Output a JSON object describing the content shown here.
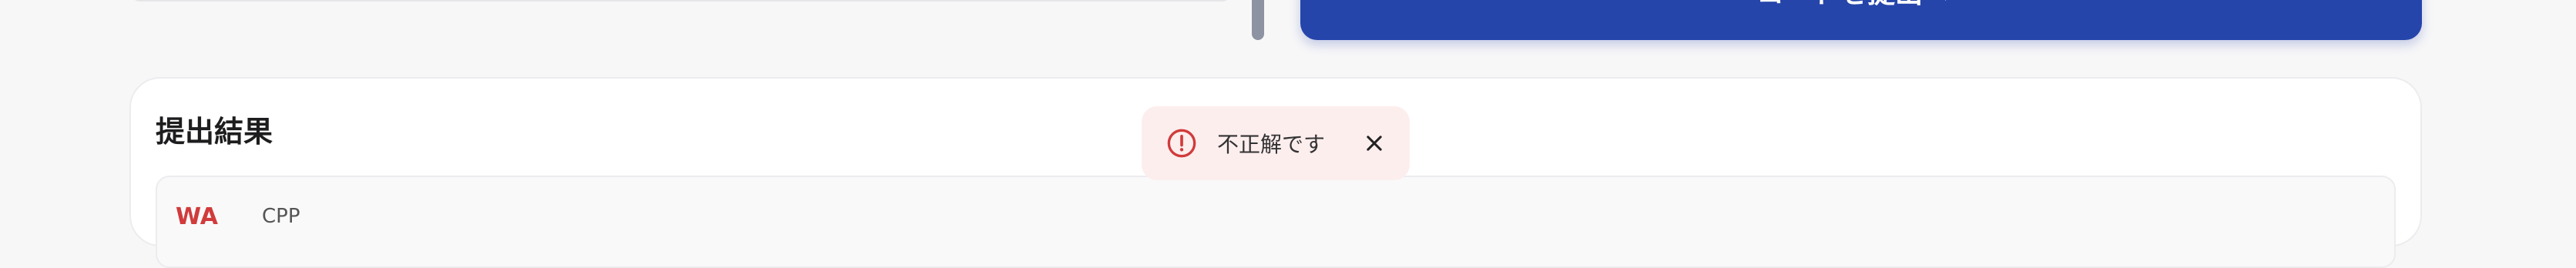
{
  "submit": {
    "label": "コードを提出"
  },
  "results": {
    "title": "提出結果",
    "rows": [
      {
        "status": "WA",
        "language": "CPP"
      }
    ]
  },
  "toast": {
    "message": "不正解です"
  },
  "colors": {
    "primary": "#2645ab",
    "error": "#d13b3b",
    "toast_bg": "#fdeeee"
  }
}
